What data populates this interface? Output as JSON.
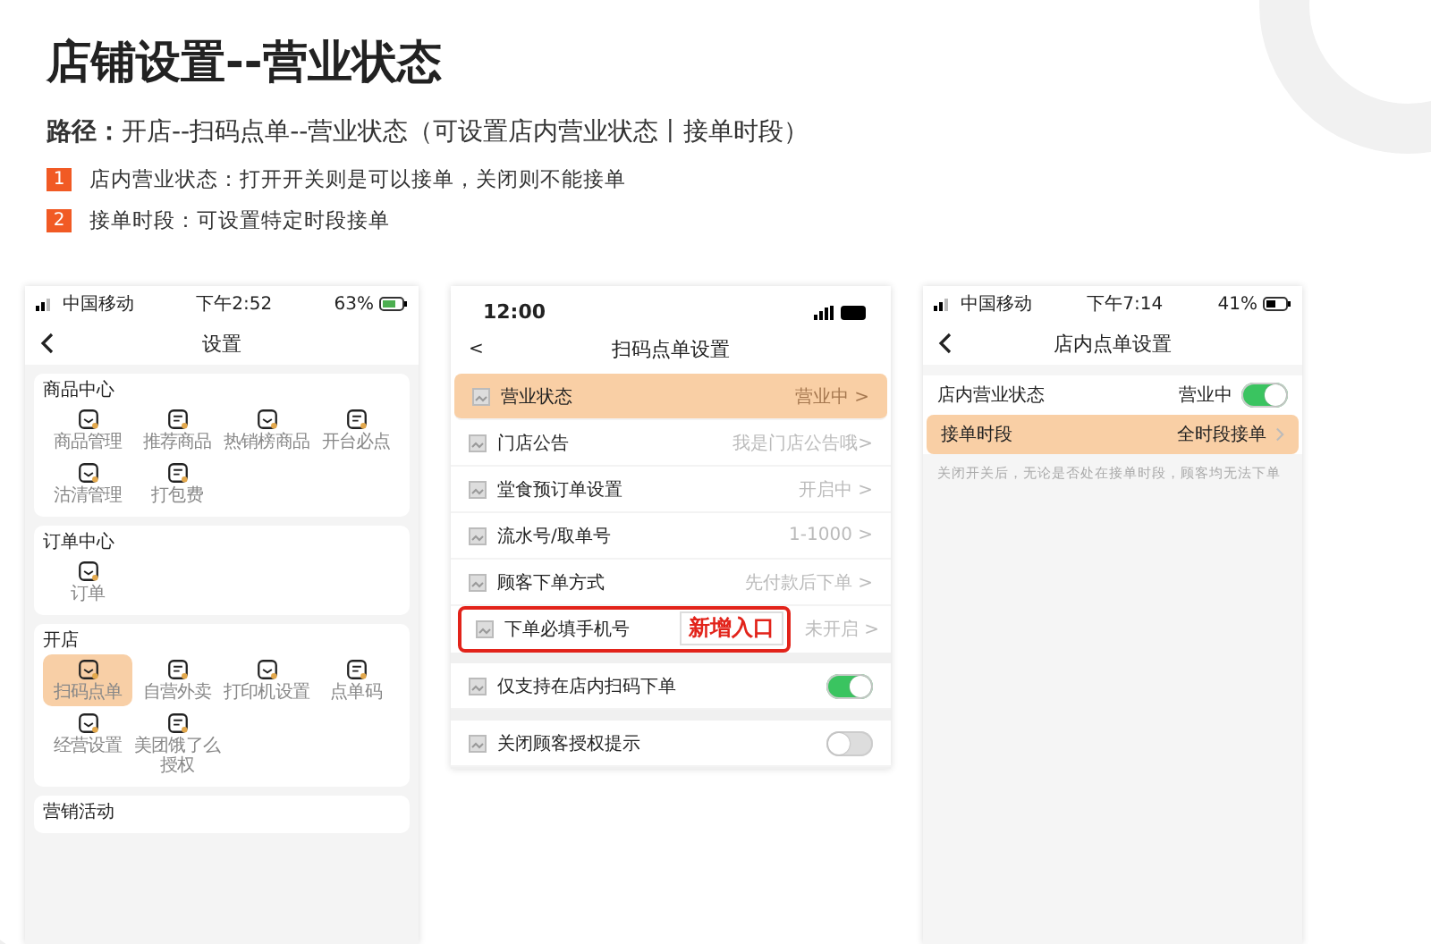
{
  "title": "店铺设置--营业状态",
  "path": {
    "label": "路径：",
    "text": "开店--扫码点单--营业状态（可设置店内营业状态丨接单时段）"
  },
  "notes": [
    {
      "number": "1",
      "text": "店内营业状态：打开开关则是可以接单，关闭则不能接单"
    },
    {
      "number": "2",
      "text": "接单时段：可设置特定时段接单"
    }
  ],
  "settings_screen": {
    "status_bar": {
      "carrier": "中国移动",
      "time": "下午2:52",
      "battery": "63%"
    },
    "nav_title": "设置",
    "sections": [
      {
        "title": "商品中心",
        "items": [
          {
            "label": "商品管理",
            "selected": false
          },
          {
            "label": "推荐商品",
            "selected": false
          },
          {
            "label": "热销榜商品",
            "selected": false
          },
          {
            "label": "开台必点",
            "selected": false
          },
          {
            "label": "沽清管理",
            "selected": false
          },
          {
            "label": "打包费",
            "selected": false
          }
        ]
      },
      {
        "title": "订单中心",
        "items": [
          {
            "label": "订单",
            "selected": false
          }
        ]
      },
      {
        "title": "开店",
        "items": [
          {
            "label": "扫码点单",
            "selected": true
          },
          {
            "label": "自营外卖",
            "selected": false
          },
          {
            "label": "打印机设置",
            "selected": false
          },
          {
            "label": "点单码",
            "selected": false
          },
          {
            "label": "经营设置",
            "selected": false
          },
          {
            "label": "美团饿了么授权",
            "selected": false
          }
        ]
      },
      {
        "title": "营销活动"
      }
    ]
  },
  "scan_order_screen": {
    "time": "12:00",
    "back": "<",
    "nav_title": "扫码点单设置",
    "groups": [
      [
        {
          "kind": "link",
          "label": "营业状态",
          "value": "营业中 >",
          "selected": true
        },
        {
          "kind": "link",
          "label": "门店公告",
          "value": "我是门店公告哦>",
          "selected": false
        },
        {
          "kind": "link",
          "label": "堂食预订单设置",
          "value": "开启中 >",
          "selected": false
        },
        {
          "kind": "link",
          "label": "流水号/取单号",
          "value": "1-1000 >",
          "selected": false
        },
        {
          "kind": "link",
          "label": "顾客下单方式",
          "value": "先付款后下单 >",
          "selected": false
        },
        {
          "kind": "link",
          "label": "下单必填手机号",
          "value": "未开启 >",
          "selected": false,
          "callout": "新增入口"
        }
      ],
      [
        {
          "kind": "toggle",
          "label": "仅支持在店内扫码下单",
          "on": true
        }
      ],
      [
        {
          "kind": "toggle",
          "label": "关闭顾客授权提示",
          "on": false
        }
      ]
    ]
  },
  "store_order_screen": {
    "status_bar": {
      "carrier": "中国移动",
      "time": "下午7:14",
      "battery": "41%"
    },
    "nav_title": "店内点单设置",
    "rows": [
      {
        "kind": "toggle",
        "label": "店内营业状态",
        "value": "营业中",
        "on": true,
        "selected": false
      },
      {
        "kind": "link",
        "label": "接单时段",
        "value": "全时段接单",
        "selected": true
      }
    ],
    "note": "关闭开关后，无论是否处在接单时段，顾客均无法下单"
  }
}
